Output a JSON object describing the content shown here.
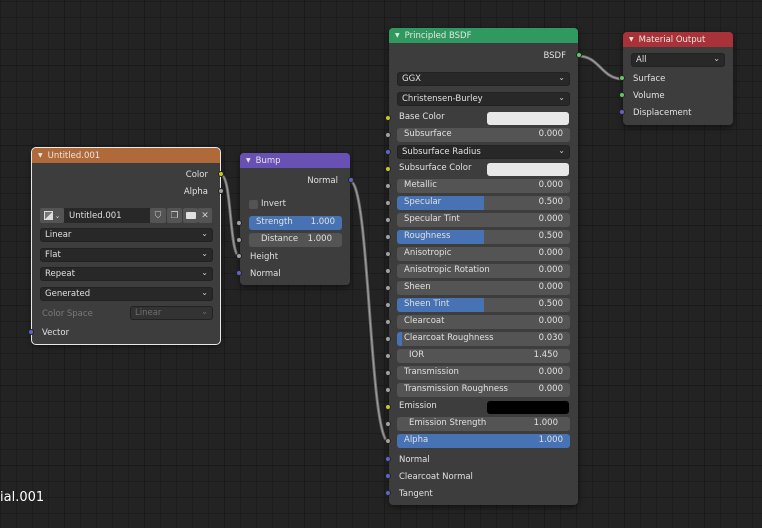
{
  "editor": {
    "material_name_partial": "ial.001"
  },
  "image_texture_node": {
    "title": "Untitled.001",
    "header_color": "#b06a3a",
    "outputs": [
      "Color",
      "Alpha"
    ],
    "image_name": "Untitled.001",
    "interpolation": "Linear",
    "projection": "Flat",
    "extension": "Repeat",
    "source": "Generated",
    "color_space_label": "Color Space",
    "color_space_value": "Linear",
    "inputs": [
      "Vector"
    ]
  },
  "bump_node": {
    "title": "Bump",
    "header_color": "#6950b5",
    "output": "Normal",
    "invert_label": "Invert",
    "invert_checked": false,
    "strength": {
      "label": "Strength",
      "value": "1.000",
      "fraction": 1.0
    },
    "distance": {
      "label": "Distance",
      "value": "1.000"
    },
    "inputs": [
      "Height",
      "Normal"
    ]
  },
  "principled_node": {
    "title": "Principled BSDF",
    "header_color": "#2f9960",
    "output": "BSDF",
    "distribution": "GGX",
    "subsurface_method": "Christensen-Burley",
    "base_color_label": "Base Color",
    "base_color": "#e8e8e8",
    "subsurface": {
      "label": "Subsurface",
      "value": "0.000"
    },
    "subsurface_radius": "Subsurface Radius",
    "subsurface_color_label": "Subsurface Color",
    "subsurface_color": "#e8e8e8",
    "sliders": [
      {
        "label": "Metallic",
        "value": "0.000",
        "fraction": 0.0
      },
      {
        "label": "Specular",
        "value": "0.500",
        "fraction": 0.5
      },
      {
        "label": "Specular Tint",
        "value": "0.000",
        "fraction": 0.0
      },
      {
        "label": "Roughness",
        "value": "0.500",
        "fraction": 0.5
      },
      {
        "label": "Anisotropic",
        "value": "0.000",
        "fraction": 0.0
      },
      {
        "label": "Anisotropic Rotation",
        "value": "0.000",
        "fraction": 0.0
      },
      {
        "label": "Sheen",
        "value": "0.000",
        "fraction": 0.0
      },
      {
        "label": "Sheen Tint",
        "value": "0.500",
        "fraction": 0.5
      },
      {
        "label": "Clearcoat",
        "value": "0.000",
        "fraction": 0.0
      },
      {
        "label": "Clearcoat Roughness",
        "value": "0.030",
        "fraction": 0.03
      }
    ],
    "ior": {
      "label": "IOR",
      "value": "1.450"
    },
    "transmission": {
      "label": "Transmission",
      "value": "0.000"
    },
    "transmission_roughness": {
      "label": "Transmission Roughness",
      "value": "0.000"
    },
    "emission_label": "Emission",
    "emission_color": "#000000",
    "emission_strength": {
      "label": "Emission Strength",
      "value": "1.000"
    },
    "alpha": {
      "label": "Alpha",
      "value": "1.000",
      "fraction": 1.0
    },
    "vector_inputs": [
      "Normal",
      "Clearcoat Normal",
      "Tangent"
    ]
  },
  "material_output_node": {
    "title": "Material Output",
    "header_color": "#a83238",
    "target": "All",
    "inputs": [
      "Surface",
      "Volume",
      "Displacement"
    ]
  }
}
